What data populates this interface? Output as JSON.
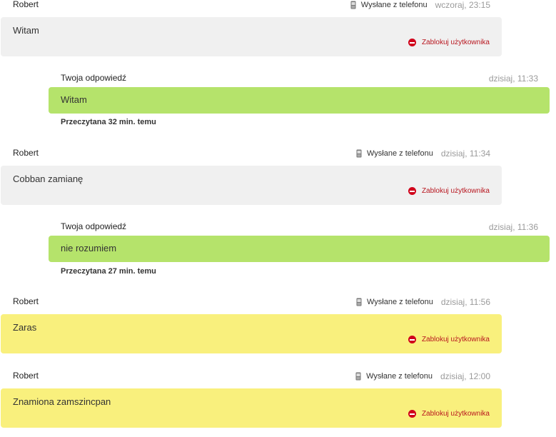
{
  "messages": [
    {
      "type": "incoming",
      "sender": "Robert",
      "device_label": "Wysłane z telefonu",
      "timestamp": "wczoraj, 23:15",
      "text": "Witam",
      "block_label": "Zablokuj użytkownika",
      "highlight": false
    },
    {
      "type": "outgoing",
      "sender": "Twoja odpowiedź",
      "timestamp": "dzisiaj, 11:33",
      "text": "Witam",
      "read_status": "Przeczytana 32 min. temu"
    },
    {
      "type": "incoming",
      "sender": "Robert",
      "device_label": "Wysłane z telefonu",
      "timestamp": "dzisiaj, 11:34",
      "text": "Cobban zamianę",
      "block_label": "Zablokuj użytkownika",
      "highlight": false
    },
    {
      "type": "outgoing",
      "sender": "Twoja odpowiedź",
      "timestamp": "dzisiaj, 11:36",
      "text": "nie rozumiem",
      "read_status": "Przeczytana 27 min. temu"
    },
    {
      "type": "incoming",
      "sender": "Robert",
      "device_label": "Wysłane z telefonu",
      "timestamp": "dzisiaj, 11:56",
      "text": "Zaras",
      "block_label": "Zablokuj użytkownika",
      "highlight": true
    },
    {
      "type": "incoming",
      "sender": "Robert",
      "device_label": "Wysłane z telefonu",
      "timestamp": "dzisiaj, 12:00",
      "text": "Znamiona zamszincpan",
      "block_label": "Zablokuj użytkownika",
      "highlight": true
    }
  ],
  "colors": {
    "incoming_bubble": "#f0f0f0",
    "highlight_bubble": "#f9f07d",
    "outgoing_bubble": "#b5e36b",
    "block_red": "#d0021b"
  },
  "icons": {
    "device": "mobile-phone-icon",
    "block": "block-user-icon"
  }
}
